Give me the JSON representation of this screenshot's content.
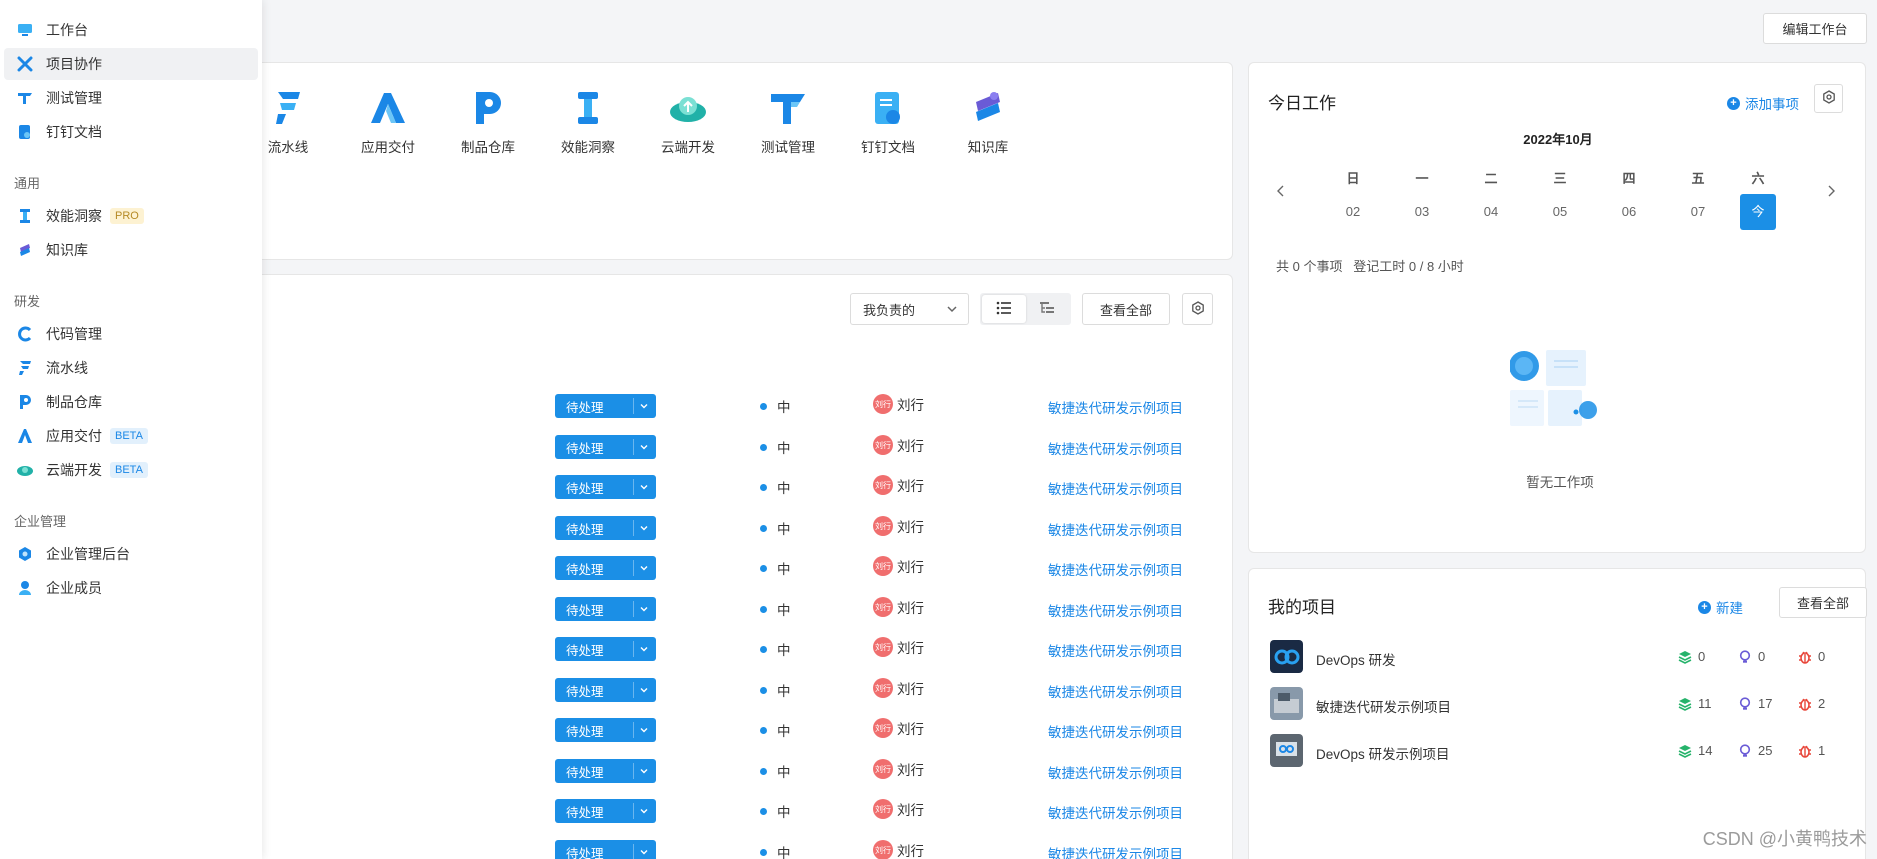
{
  "sidebar": {
    "top_items": [
      {
        "label": "工作台"
      },
      {
        "label": "项目协作"
      },
      {
        "label": "测试管理"
      },
      {
        "label": "钉钉文档"
      }
    ],
    "groups": [
      {
        "title": "通用",
        "items": [
          {
            "label": "效能洞察",
            "badge": "PRO"
          },
          {
            "label": "知识库",
            "badge": ""
          }
        ]
      },
      {
        "title": "研发",
        "items": [
          {
            "label": "代码管理",
            "badge": ""
          },
          {
            "label": "流水线",
            "badge": ""
          },
          {
            "label": "制品仓库",
            "badge": ""
          },
          {
            "label": "应用交付",
            "badge": "BETA"
          },
          {
            "label": "云端开发",
            "badge": "BETA"
          }
        ]
      },
      {
        "title": "企业管理",
        "items": [
          {
            "label": "企业管理后台",
            "badge": ""
          },
          {
            "label": "企业成员",
            "badge": ""
          }
        ]
      }
    ]
  },
  "header": {
    "edit_label": "编辑工作台"
  },
  "apps": [
    {
      "label": "流水线"
    },
    {
      "label": "应用交付"
    },
    {
      "label": "制品仓库"
    },
    {
      "label": "效能洞察"
    },
    {
      "label": "云端开发"
    },
    {
      "label": "测试管理"
    },
    {
      "label": "钉钉文档"
    },
    {
      "label": "知识库"
    }
  ],
  "tasks": {
    "filter_label": "我负责的",
    "view_all_label": "查看全部",
    "rows": [
      {
        "status": "待处理",
        "priority": "中",
        "owner_avatar": "刘行",
        "owner": "刘行",
        "project": "敏捷迭代研发示例项目"
      },
      {
        "status": "待处理",
        "priority": "中",
        "owner_avatar": "刘行",
        "owner": "刘行",
        "project": "敏捷迭代研发示例项目"
      },
      {
        "status": "待处理",
        "priority": "中",
        "owner_avatar": "刘行",
        "owner": "刘行",
        "project": "敏捷迭代研发示例项目"
      },
      {
        "status": "待处理",
        "priority": "中",
        "owner_avatar": "刘行",
        "owner": "刘行",
        "project": "敏捷迭代研发示例项目"
      },
      {
        "status": "待处理",
        "priority": "中",
        "owner_avatar": "刘行",
        "owner": "刘行",
        "project": "敏捷迭代研发示例项目"
      },
      {
        "status": "待处理",
        "priority": "中",
        "owner_avatar": "刘行",
        "owner": "刘行",
        "project": "敏捷迭代研发示例项目"
      },
      {
        "status": "待处理",
        "priority": "中",
        "owner_avatar": "刘行",
        "owner": "刘行",
        "project": "敏捷迭代研发示例项目"
      },
      {
        "status": "待处理",
        "priority": "中",
        "owner_avatar": "刘行",
        "owner": "刘行",
        "project": "敏捷迭代研发示例项目"
      },
      {
        "status": "待处理",
        "priority": "中",
        "owner_avatar": "刘行",
        "owner": "刘行",
        "project": "敏捷迭代研发示例项目"
      },
      {
        "status": "待处理",
        "priority": "中",
        "owner_avatar": "刘行",
        "owner": "刘行",
        "project": "敏捷迭代研发示例项目"
      },
      {
        "status": "待处理",
        "priority": "中",
        "owner_avatar": "刘行",
        "owner": "刘行",
        "project": "敏捷迭代研发示例项目"
      },
      {
        "status": "待处理",
        "priority": "中",
        "owner_avatar": "刘行",
        "owner": "刘行",
        "project": "敏捷迭代研发示例项目"
      }
    ]
  },
  "today": {
    "title": "今日工作",
    "add_label": "添加事项",
    "month": "2022年10月",
    "weekdays": [
      "日",
      "一",
      "二",
      "三",
      "四",
      "五",
      "六"
    ],
    "days": [
      "02",
      "03",
      "04",
      "05",
      "06",
      "07",
      "今"
    ],
    "summary": "共 0 个事项   登记工时 0 / 8 小时",
    "empty": "暂无工作项"
  },
  "projects": {
    "title": "我的项目",
    "new_label": "新建",
    "view_all_label": "查看全部",
    "items": [
      {
        "name": "DevOps 研发",
        "stat1": "0",
        "stat2": "0",
        "stat3": "0"
      },
      {
        "name": "敏捷迭代研发示例项目",
        "stat1": "11",
        "stat2": "17",
        "stat3": "2"
      },
      {
        "name": "DevOps 研发示例项目",
        "stat1": "14",
        "stat2": "25",
        "stat3": "1"
      }
    ]
  },
  "watermark": "CSDN @小黄鸭技术",
  "colors": {
    "accent": "#1b8fe6",
    "link": "#1b87e6",
    "avatar": "#f06e6e"
  }
}
